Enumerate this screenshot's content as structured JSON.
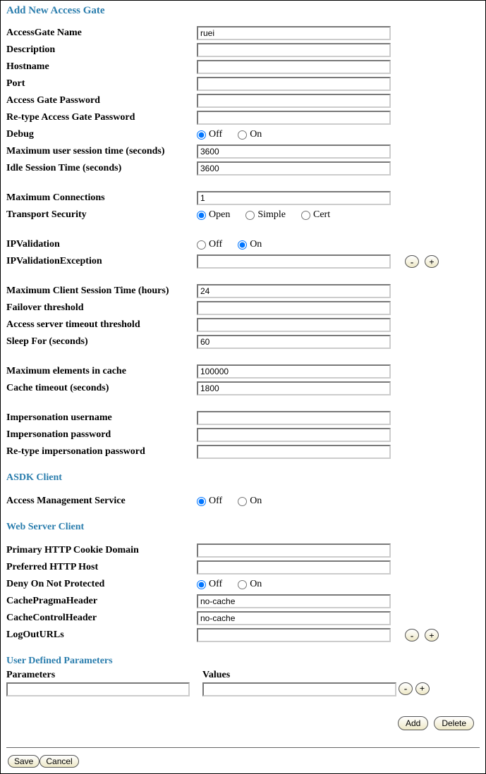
{
  "title": "Add New Access Gate",
  "labels": {
    "name": "AccessGate Name",
    "description": "Description",
    "hostname": "Hostname",
    "port": "Port",
    "agpw": "Access Gate Password",
    "reagpw": "Re-type Access Gate Password",
    "debug": "Debug",
    "maxusersess": "Maximum user session time (seconds)",
    "idlesess": "Idle Session Time (seconds)",
    "maxconn": "Maximum Connections",
    "tsec": "Transport Security",
    "ipval": "IPValidation",
    "ipvalex": "IPValidationException",
    "maxcli": "Maximum Client Session Time (hours)",
    "failover": "Failover threshold",
    "astimeout": "Access server timeout threshold",
    "sleep": "Sleep For (seconds)",
    "maxcache": "Maximum elements in cache",
    "cachetimeout": "Cache timeout (seconds)",
    "impuser": "Impersonation username",
    "imppw": "Impersonation password",
    "reimppw": "Re-type impersonation password",
    "ams": "Access Management Service",
    "cookie": "Primary HTTP Cookie Domain",
    "prefhost": "Preferred HTTP Host",
    "deny": "Deny On Not Protected",
    "cpragma": "CachePragmaHeader",
    "cctrl": "CacheControlHeader",
    "logout": "LogOutURLs",
    "params": "Parameters",
    "values": "Values"
  },
  "sections": {
    "asdk": "ASDK Client",
    "web": "Web Server Client",
    "udp": "User Defined Parameters"
  },
  "radio": {
    "off": "Off",
    "on": "On",
    "open": "Open",
    "simple": "Simple",
    "cert": "Cert"
  },
  "values": {
    "name": "ruei",
    "description": "",
    "hostname": "",
    "port": "",
    "agpw": "",
    "reagpw": "",
    "debug": "Off",
    "maxusersess": "3600",
    "idlesess": "3600",
    "maxconn": "1",
    "tsec": "Open",
    "ipval": "On",
    "ipvalex": "",
    "maxcli": "24",
    "failover": "",
    "astimeout": "",
    "sleep": "60",
    "maxcache": "100000",
    "cachetimeout": "1800",
    "impuser": "",
    "imppw": "",
    "reimppw": "",
    "ams": "Off",
    "cookie": "",
    "prefhost": "",
    "deny": "Off",
    "cpragma": "no-cache",
    "cctrl": "no-cache",
    "logout": "",
    "param_name": "",
    "param_value": ""
  },
  "buttons": {
    "minus": "-",
    "plus": "+",
    "add": "Add",
    "delete": "Delete",
    "save": "Save",
    "cancel": "Cancel"
  }
}
